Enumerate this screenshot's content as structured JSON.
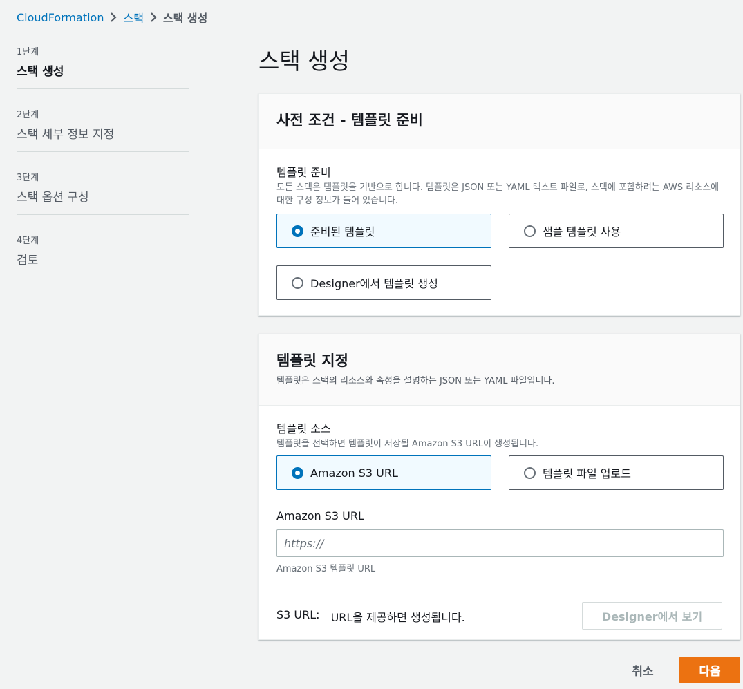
{
  "breadcrumb": {
    "items": [
      {
        "label": "CloudFormation"
      },
      {
        "label": "스택"
      },
      {
        "label": "스택 생성"
      }
    ]
  },
  "steps": [
    {
      "number": "1단계",
      "title": "스택 생성"
    },
    {
      "number": "2단계",
      "title": "스택 세부 정보 지정"
    },
    {
      "number": "3단계",
      "title": "스택 옵션 구성"
    },
    {
      "number": "4단계",
      "title": "검토"
    }
  ],
  "page_title": "스택 생성",
  "prereq_panel": {
    "title": "사전 조건 - 템플릿 준비",
    "field_label": "템플릿 준비",
    "field_desc": "모든 스택은 템플릿을 기반으로 합니다. 템플릿은 JSON 또는 YAML 텍스트 파일로, 스택에 포함하려는 AWS 리소스에 대한 구성 정보가 들어 있습니다.",
    "options": [
      {
        "label": "준비된 템플릿",
        "selected": true
      },
      {
        "label": "샘플 템플릿 사용",
        "selected": false
      },
      {
        "label": "Designer에서 템플릿 생성",
        "selected": false
      }
    ]
  },
  "template_panel": {
    "title": "템플릿 지정",
    "desc": "템플릿은 스택의 리소스와 속성을 설명하는 JSON 또는 YAML 파일입니다.",
    "source_label": "템플릿 소스",
    "source_desc": "템플릿을 선택하면 템플릿이 저장될 Amazon S3 URL이 생성됩니다.",
    "options": [
      {
        "label": "Amazon S3 URL",
        "selected": true
      },
      {
        "label": "템플릿 파일 업로드",
        "selected": false
      }
    ],
    "url_label": "Amazon S3 URL",
    "url_placeholder": "https://",
    "url_value": "",
    "url_hint": "Amazon S3 템플릿 URL",
    "s3_url_key": "S3 URL:",
    "s3_url_value": "URL을 제공하면 생성됩니다.",
    "designer_button": "Designer에서 보기"
  },
  "actions": {
    "cancel": "취소",
    "next": "다음"
  }
}
